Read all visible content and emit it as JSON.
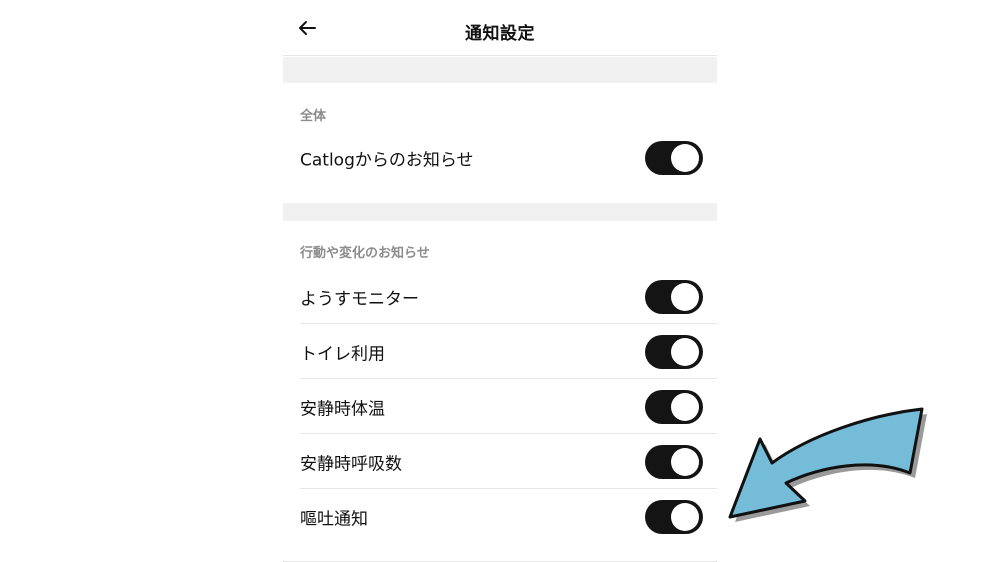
{
  "header": {
    "title": "通知設定",
    "back_icon": "arrow-left-icon"
  },
  "sections": [
    {
      "label": "全体",
      "items": [
        {
          "label": "Catlogからのお知らせ",
          "enabled": true
        }
      ]
    },
    {
      "label": "行動や変化のお知らせ",
      "items": [
        {
          "label": "ようすモニター",
          "enabled": true
        },
        {
          "label": "トイレ利用",
          "enabled": true
        },
        {
          "label": "安静時体温",
          "enabled": true
        },
        {
          "label": "安静時呼吸数",
          "enabled": true
        },
        {
          "label": "嘔吐通知",
          "enabled": true
        }
      ]
    }
  ],
  "colors": {
    "toggle_on": "#141414",
    "toggle_knob": "#ffffff",
    "band": "#f1f1f1",
    "section_label": "#8c8c8c",
    "annotation_arrow": "#74bcd8"
  },
  "annotation": {
    "icon": "curved-arrow-pointer-icon"
  }
}
